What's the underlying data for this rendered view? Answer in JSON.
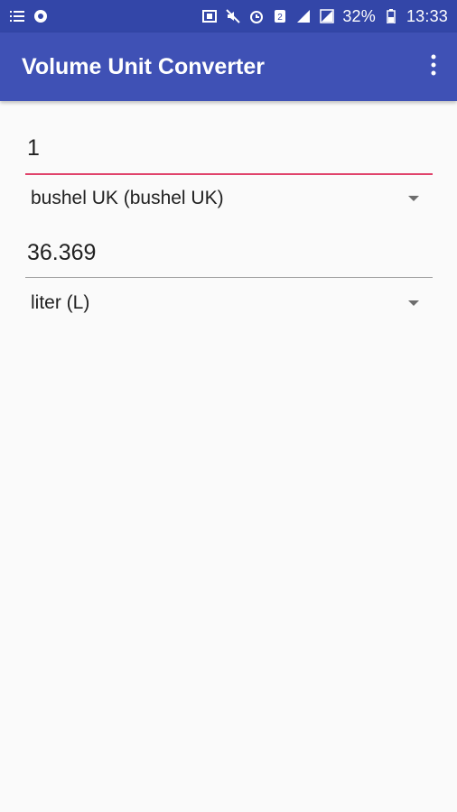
{
  "status_bar": {
    "battery_percent": "32%",
    "time": "13:33",
    "icons": [
      "list-icon",
      "bug-icon",
      "nfc-icon",
      "mute-icon",
      "alarm-icon",
      "sim2-icon",
      "signal-icon",
      "signal-icon",
      "battery-icon"
    ]
  },
  "app_bar": {
    "title": "Volume Unit Converter",
    "menu_icon": "more-vert-icon"
  },
  "converter": {
    "input_value": "1",
    "from_unit": "bushel UK (bushel UK)",
    "result_value": "36.369",
    "to_unit": "liter (L)"
  },
  "colors": {
    "status_bar": "#3346a8",
    "app_bar": "#3f51b5",
    "accent": "#e0436b",
    "background": "#fafafa"
  }
}
